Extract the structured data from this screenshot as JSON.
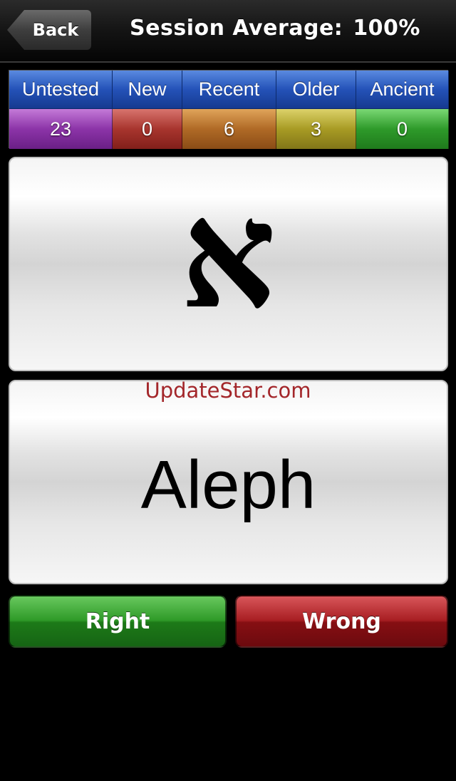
{
  "nav": {
    "back_label": "Back",
    "session_label": "Session Average:",
    "session_value": "100%"
  },
  "stats": {
    "columns": [
      {
        "label": "Untested",
        "count": "23",
        "color": "#8c34a8"
      },
      {
        "label": "New",
        "count": "0",
        "color": "#a8352e"
      },
      {
        "label": "Recent",
        "count": "6",
        "color": "#b06a26"
      },
      {
        "label": "Older",
        "count": "3",
        "color": "#a89b24"
      },
      {
        "label": "Ancient",
        "count": "0",
        "color": "#2e9a2a"
      }
    ],
    "header_color": "#2452b8"
  },
  "card": {
    "symbol": "א",
    "name": "Aleph"
  },
  "watermark": "UpdateStar.com",
  "actions": {
    "right_label": "Right",
    "wrong_label": "Wrong",
    "right_color": "#2f9a28",
    "wrong_color": "#a81e22"
  }
}
